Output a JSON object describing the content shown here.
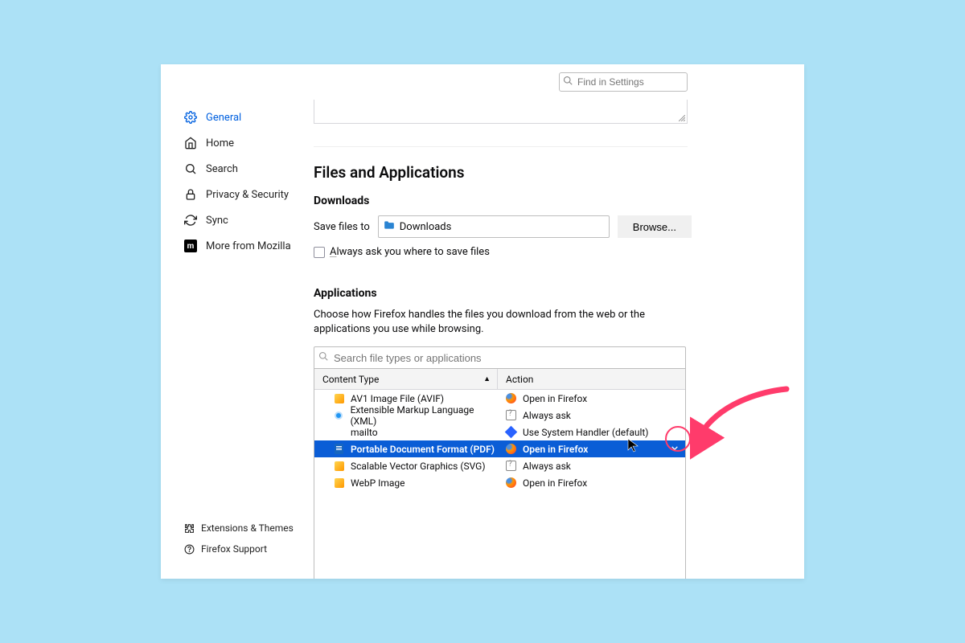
{
  "top_search": {
    "placeholder": "Find in Settings"
  },
  "sidebar": {
    "items": [
      {
        "label": "General",
        "active": true,
        "icon": "gear"
      },
      {
        "label": "Home",
        "active": false,
        "icon": "home"
      },
      {
        "label": "Search",
        "active": false,
        "icon": "search"
      },
      {
        "label": "Privacy & Security",
        "active": false,
        "icon": "lock"
      },
      {
        "label": "Sync",
        "active": false,
        "icon": "sync"
      },
      {
        "label": "More from Mozilla",
        "active": false,
        "icon": "mozilla"
      }
    ],
    "bottom": [
      {
        "label": "Extensions & Themes",
        "icon": "puzzle"
      },
      {
        "label": "Firefox Support",
        "icon": "question"
      }
    ]
  },
  "main": {
    "section_title": "Files and Applications",
    "downloads": {
      "heading": "Downloads",
      "save_label": "Save files to",
      "path": "Downloads",
      "browse": "Browse...",
      "always_ask": "Always ask you where to save files"
    },
    "applications": {
      "heading": "Applications",
      "description": "Choose how Firefox handles the files you download from the web or the applications you use while browsing.",
      "search_placeholder": "Search file types or applications",
      "columns": {
        "content_type": "Content Type",
        "action": "Action"
      },
      "rows": [
        {
          "type": "AV1 Image File (AVIF)",
          "type_icon": "img",
          "action": "Open in Firefox",
          "action_icon": "firefox",
          "selected": false
        },
        {
          "type": "Extensible Markup Language (XML)",
          "type_icon": "xml",
          "action": "Always ask",
          "action_icon": "ask",
          "selected": false
        },
        {
          "type": "mailto",
          "type_icon": "none",
          "action": "Use System Handler (default)",
          "action_icon": "sys",
          "selected": false
        },
        {
          "type": "Portable Document Format (PDF)",
          "type_icon": "pdf",
          "action": "Open in Firefox",
          "action_icon": "firefox",
          "selected": true
        },
        {
          "type": "Scalable Vector Graphics (SVG)",
          "type_icon": "img",
          "action": "Always ask",
          "action_icon": "ask",
          "selected": false
        },
        {
          "type": "WebP Image",
          "type_icon": "img",
          "action": "Open in Firefox",
          "action_icon": "firefox",
          "selected": false
        }
      ]
    }
  }
}
